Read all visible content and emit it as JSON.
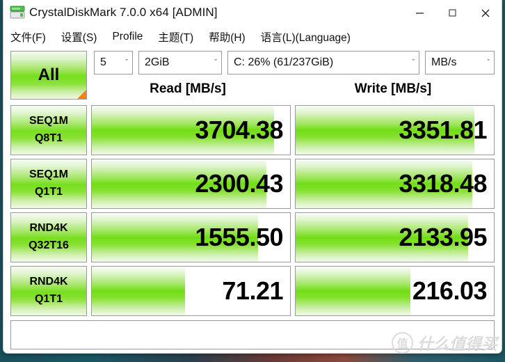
{
  "window": {
    "title": "CrystalDiskMark 7.0.0 x64 [ADMIN]",
    "app_icon": "disk-drive-icon",
    "controls": {
      "minimize": "minimize-icon",
      "maximize": "maximize-icon",
      "close": "close-icon"
    }
  },
  "menu": {
    "items": [
      {
        "label": "文件(F)"
      },
      {
        "label": "设置(S)"
      },
      {
        "label": "Profile"
      },
      {
        "label": "主题(T)"
      },
      {
        "label": "帮助(H)"
      },
      {
        "label": "语言(L)(Language)"
      }
    ]
  },
  "toolbar": {
    "all_button": "All",
    "test_count": "5",
    "test_size": "2GiB",
    "target_drive": "C: 26% (61/237GiB)",
    "unit": "MB/s",
    "chevron": "ˇ"
  },
  "columns": {
    "read": "Read [MB/s]",
    "write": "Write [MB/s]"
  },
  "statusbar": {
    "text": "",
    "watermark_mark": "值",
    "watermark_text": "什么值得买"
  },
  "colors": {
    "accent_green": "#72de16",
    "button_corner_orange": "#f98014",
    "border_gray": "#9a9a9a",
    "window_bg": "#ffffff"
  },
  "chart_data": {
    "type": "bar",
    "title": "CrystalDiskMark 7.0.0 x64 [ADMIN]",
    "unit": "MB/s",
    "test_count": 5,
    "test_size": "2GiB",
    "target": "C: 26% (61/237GiB)",
    "categories": [
      "SEQ1M Q8T1",
      "SEQ1M Q1T1",
      "RND4K Q32T16",
      "RND4K Q1T1"
    ],
    "series": [
      {
        "name": "Read [MB/s]",
        "values": [
          3704.38,
          2300.43,
          1555.5,
          71.21
        ]
      },
      {
        "name": "Write [MB/s]",
        "values": [
          3351.81,
          3318.48,
          2133.95,
          216.03
        ]
      }
    ],
    "rows": [
      {
        "test_line1": "SEQ1M",
        "test_line2": "Q8T1",
        "read_value": "3704.38",
        "read_fill": 92,
        "write_value": "3351.81",
        "write_fill": 90
      },
      {
        "test_line1": "SEQ1M",
        "test_line2": "Q1T1",
        "read_value": "2300.43",
        "read_fill": 88,
        "write_value": "3318.48",
        "write_fill": 89
      },
      {
        "test_line1": "RND4K",
        "test_line2": "Q32T16",
        "read_value": "1555.50",
        "read_fill": 84,
        "write_value": "2133.95",
        "write_fill": 87
      },
      {
        "test_line1": "RND4K",
        "test_line2": "Q1T1",
        "read_value": "71.21",
        "read_fill": 47,
        "write_value": "216.03",
        "write_fill": 58
      }
    ],
    "xlabel": "",
    "ylabel": "MB/s",
    "grid": false,
    "legend": "top"
  }
}
